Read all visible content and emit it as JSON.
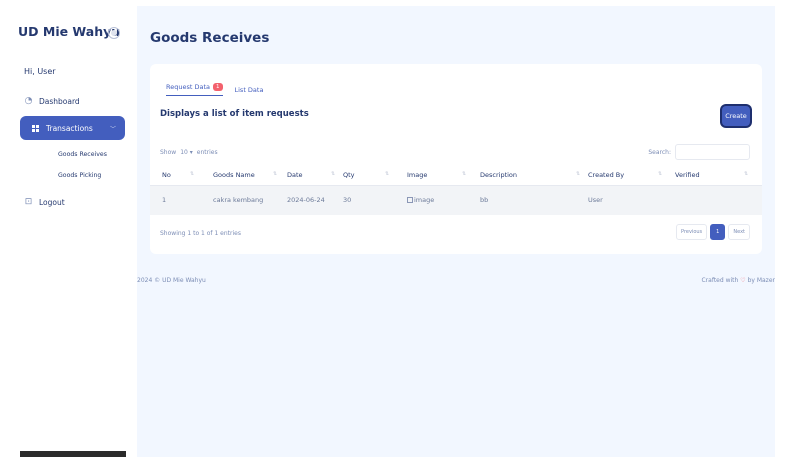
{
  "sidebar": {
    "brand": "UD Mie Wahyu",
    "greeting": "Hi, User",
    "items": [
      {
        "label": "Dashboard"
      },
      {
        "label": "Transactions"
      },
      {
        "label": "Goods Receives"
      },
      {
        "label": "Goods Picking"
      },
      {
        "label": "Logout"
      }
    ]
  },
  "main": {
    "title": "Goods Receives",
    "tabs": [
      {
        "label": "Request Data",
        "badge": "1"
      },
      {
        "label": "List Data"
      }
    ],
    "subtitle": "Displays a list of item requests",
    "create_label": "Create",
    "show_label": "Show",
    "show_value": "10",
    "entries_label": "entries",
    "search_label": "Search:",
    "columns": [
      "No",
      "Goods Name",
      "Date",
      "Qty",
      "Image",
      "Description",
      "Created By",
      "Verified"
    ],
    "rows": [
      {
        "no": "1",
        "goods_name": "cakra kembang",
        "date": "2024-06-24",
        "qty": "30",
        "image": "image",
        "description": "bb",
        "created_by": "User",
        "verified": ""
      }
    ],
    "showing": "Showing 1 to 1 of 1 entries",
    "pager": {
      "prev": "Previous",
      "current": "1",
      "next": "Next"
    }
  },
  "footer": {
    "left": "2024 © UD Mie Wahyu",
    "right_prefix": "Crafted with",
    "right_suffix": "by Mazer"
  },
  "colors": {
    "accent": "#435ebe",
    "background": "#f2f7ff",
    "badge": "#f3616d"
  }
}
